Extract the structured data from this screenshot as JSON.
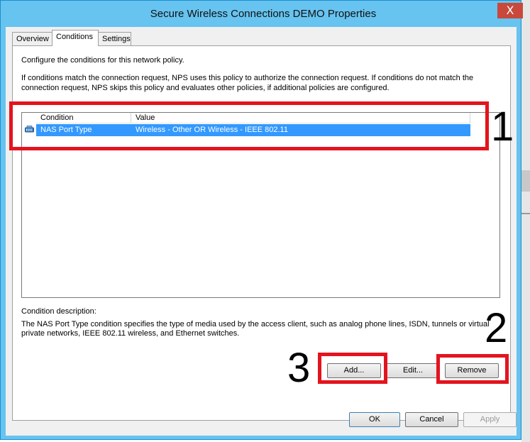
{
  "window": {
    "title": "Secure Wireless Connections DEMO Properties",
    "close_glyph": "X"
  },
  "tabs": [
    {
      "label": "Overview",
      "active": false
    },
    {
      "label": "Conditions",
      "active": true
    },
    {
      "label": "Settings",
      "active": false
    }
  ],
  "conditions_tab": {
    "intro": "Configure the conditions for this network policy.",
    "explanation_line1": "If conditions match the connection request, NPS uses this policy to authorize the connection request. If conditions do not match the",
    "explanation_line2": "connection request, NPS skips this policy and evaluates other policies, if additional policies are configured.",
    "table": {
      "columns": [
        "Condition",
        "Value"
      ],
      "rows": [
        {
          "condition": "NAS Port Type",
          "value": "Wireless - Other OR Wireless - IEEE 802.11",
          "icon": "network-cable-icon",
          "selected": true
        }
      ]
    },
    "description_label": "Condition description:",
    "description_line1": "The NAS Port Type condition specifies the type of media used by the access client, such as analog phone lines, ISDN, tunnels or virtual",
    "description_line2": "private networks, IEEE 802.11 wireless, and Ethernet switches.",
    "buttons": {
      "add": "Add...",
      "edit": "Edit...",
      "remove": "Remove"
    }
  },
  "footer_buttons": {
    "ok": "OK",
    "cancel": "Cancel",
    "apply": "Apply"
  },
  "annotations": {
    "one": "1",
    "two": "2",
    "three": "3",
    "color": "#e3141e"
  }
}
